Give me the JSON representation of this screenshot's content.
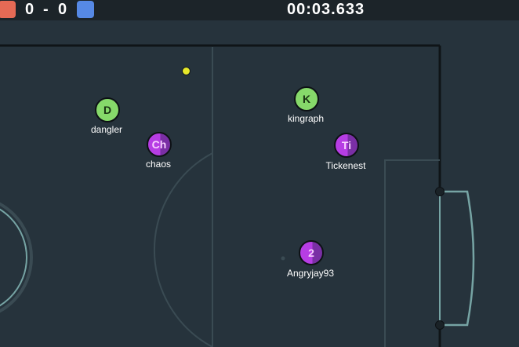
{
  "scoreboard": {
    "red_score": "0",
    "separator": "-",
    "blue_score": "0",
    "timer": "00:03.633",
    "red_color": "#e56a55",
    "blue_color": "#5689e5"
  },
  "field": {
    "background_color": "#26333c",
    "line_color": "#3a4b53",
    "goal_color": "#76a4a4"
  },
  "players": [
    {
      "name": "dangler",
      "avatar": "D",
      "team": "green"
    },
    {
      "name": "chaos",
      "avatar": "Ch",
      "team": "purple"
    },
    {
      "name": "kingraph",
      "avatar": "K",
      "team": "green"
    },
    {
      "name": "Tickenest",
      "avatar": "Ti",
      "team": "purple"
    },
    {
      "name": "Angryjay93",
      "avatar": "2",
      "team": "purple"
    }
  ],
  "team_colors": {
    "green": "#86d96a",
    "purple": "#b63de4"
  }
}
